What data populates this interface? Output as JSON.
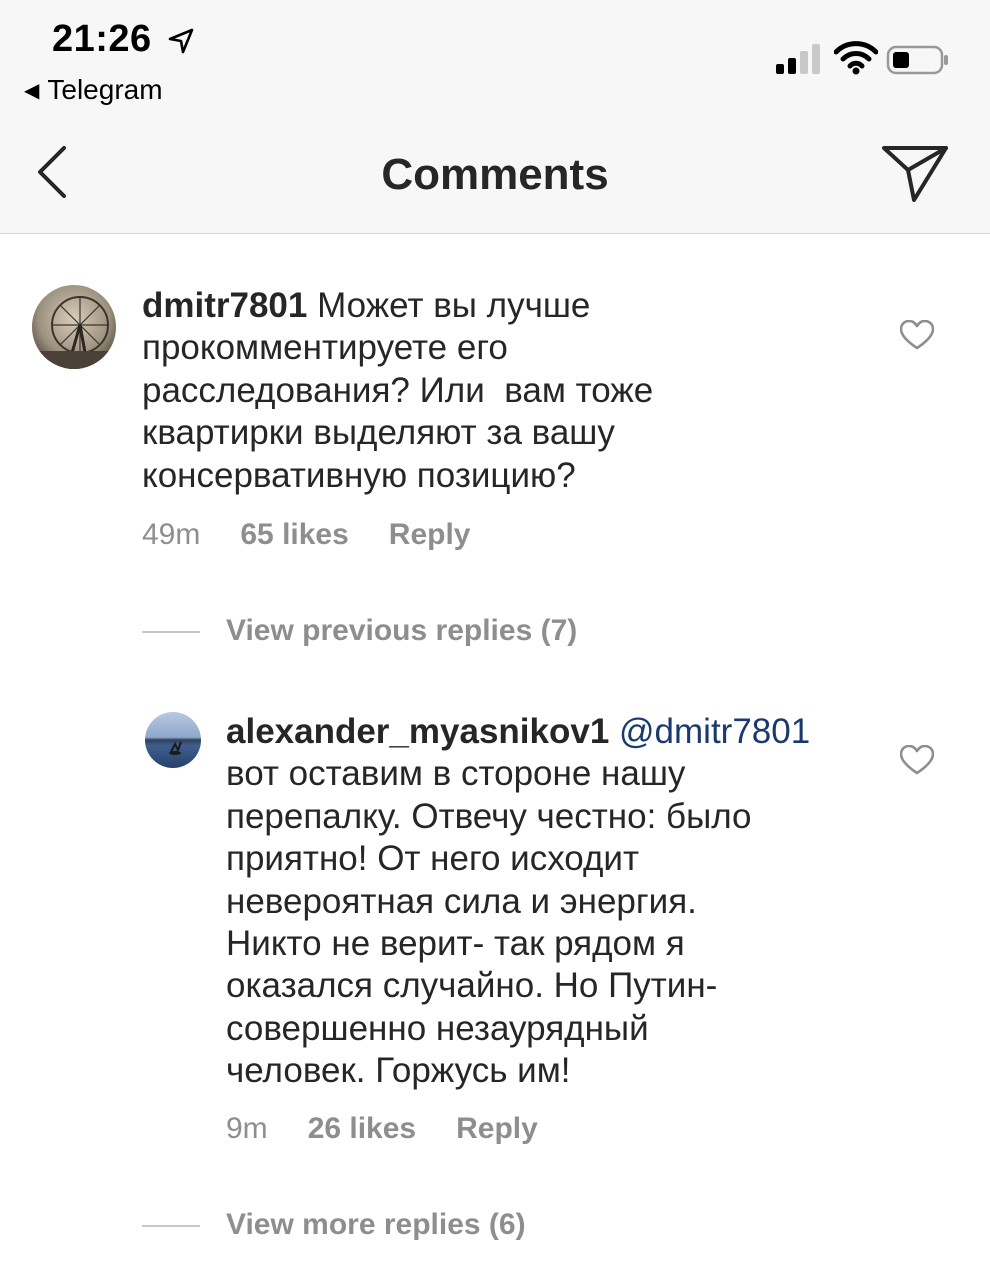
{
  "status_bar": {
    "time": "21:26",
    "back_app": "Telegram",
    "icons": [
      "location-arrow-icon",
      "cellular-signal-icon",
      "wifi-icon",
      "battery-icon"
    ]
  },
  "nav": {
    "title": "Comments",
    "icons": [
      "back-chevron-icon",
      "send-icon"
    ]
  },
  "comments": [
    {
      "username": "dmitr7801",
      "mention": "",
      "lines": [
        "Может вы лучше",
        "прокомментируете его",
        "расследования? Или  вам тоже",
        "квартирки выделяют за вашу",
        "консервативную позицию?"
      ],
      "time": "49m",
      "likes": "65 likes",
      "reply": "Reply"
    },
    {
      "username": "alexander_myasnikov1",
      "mention": "@dmitr7801",
      "lines": [
        "вот оставим в стороне нашу",
        "перепалку. Отвечу честно: было",
        "приятно! От него исходит",
        "невероятная сила и энергия.",
        "Никто не верит- так рядом я",
        "оказался случайно. Но Путин-",
        "совершенно незаурядный",
        "человек. Горжусь им!"
      ],
      "time": "9m",
      "likes": "26 likes",
      "reply": "Reply"
    }
  ],
  "view_previous_replies": "View previous replies (7)",
  "view_more_replies": "View more replies (6)",
  "colors": {
    "text": "#262626",
    "secondary": "#8e8e8e",
    "mention": "#1a3a6d",
    "bar_bg": "#f7f7f7"
  }
}
